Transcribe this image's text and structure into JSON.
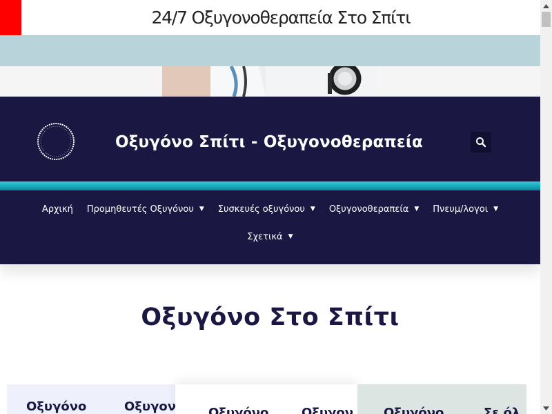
{
  "banner": {
    "text": "24/7 Οξυγονοθεραπεία Στο Σπίτι",
    "accent_color": "#ff0000"
  },
  "header": {
    "logo_icon": "circular-text-logo-icon",
    "title": "Οξυγόνο Σπίτι - Οξυγονοθεραπεία",
    "search_icon": "search-icon",
    "background_color": "#1a1842",
    "accent_color": "#1fb3c6"
  },
  "nav": {
    "items": [
      {
        "label": "Αρχική",
        "has_dropdown": false
      },
      {
        "label": "Προμηθευτές Οξυγόνου",
        "has_dropdown": true
      },
      {
        "label": "Συσκευές οξυγόνου",
        "has_dropdown": true
      },
      {
        "label": "Οξυγονοθεραπεία",
        "has_dropdown": true
      },
      {
        "label": "Πνευμ/λογοι",
        "has_dropdown": true
      },
      {
        "label": "Σχετικά",
        "has_dropdown": true
      }
    ],
    "caret_glyph": "▼"
  },
  "main": {
    "title": "Οξυγόνο Στο Σπίτι",
    "cards": [
      {
        "left": "Οξυγόνο",
        "right": "Οξυγον"
      },
      {
        "left": "Οξυγόνο",
        "right": "Οξυγον"
      },
      {
        "left": "Οξυγόνο",
        "right": "Σε όλ"
      }
    ]
  }
}
